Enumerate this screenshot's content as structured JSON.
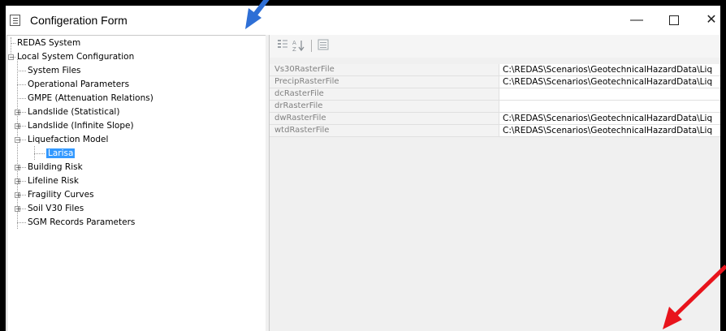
{
  "window": {
    "title": "Configeration Form",
    "controls": {
      "minimize": "—",
      "close": "✕"
    }
  },
  "tree": {
    "items": [
      {
        "label": "REDAS System",
        "level": 0,
        "expander": ""
      },
      {
        "label": "Local System Configuration",
        "level": 0,
        "expander": "−"
      },
      {
        "label": "System Files",
        "level": 1,
        "expander": ""
      },
      {
        "label": "Operational Parameters",
        "level": 1,
        "expander": ""
      },
      {
        "label": "GMPE (Attenuation Relations)",
        "level": 1,
        "expander": ""
      },
      {
        "label": "Landslide (Statistical)",
        "level": 1,
        "expander": "+"
      },
      {
        "label": "Landslide (Infinite Slope)",
        "level": 1,
        "expander": "+"
      },
      {
        "label": "Liquefaction Model",
        "level": 1,
        "expander": "−"
      },
      {
        "label": "Larisa",
        "level": 2,
        "expander": "",
        "selected": true
      },
      {
        "label": "Building Risk",
        "level": 1,
        "expander": "+"
      },
      {
        "label": "Lifeline Risk",
        "level": 1,
        "expander": "+"
      },
      {
        "label": "Fragility Curves",
        "level": 1,
        "expander": "+"
      },
      {
        "label": "Soil V30 Files",
        "level": 1,
        "expander": "+"
      },
      {
        "label": "SGM Records Parameters",
        "level": 1,
        "expander": ""
      }
    ]
  },
  "properties": {
    "toolbar": {
      "categorized_icon": "categorized-icon",
      "alphabetical_icon": "sort-alphabetical-icon",
      "property_pages_icon": "property-pages-icon"
    },
    "rows": [
      {
        "name": "Vs30RasterFile",
        "value": "C:\\REDAS\\Scenarios\\GeotechnicalHazardData\\Liq"
      },
      {
        "name": "PrecipRasterFile",
        "value": "C:\\REDAS\\Scenarios\\GeotechnicalHazardData\\Liq"
      },
      {
        "name": "dcRasterFile",
        "value": ""
      },
      {
        "name": "drRasterFile",
        "value": ""
      },
      {
        "name": "dwRasterFile",
        "value": "C:\\REDAS\\Scenarios\\GeotechnicalHazardData\\Liq"
      },
      {
        "name": "wtdRasterFile",
        "value": "C:\\REDAS\\Scenarios\\GeotechnicalHazardData\\Liq"
      }
    ]
  },
  "annotations": {
    "blue_arrow_color": "#2e6fd6",
    "red_arrow_color": "#e8141c"
  }
}
